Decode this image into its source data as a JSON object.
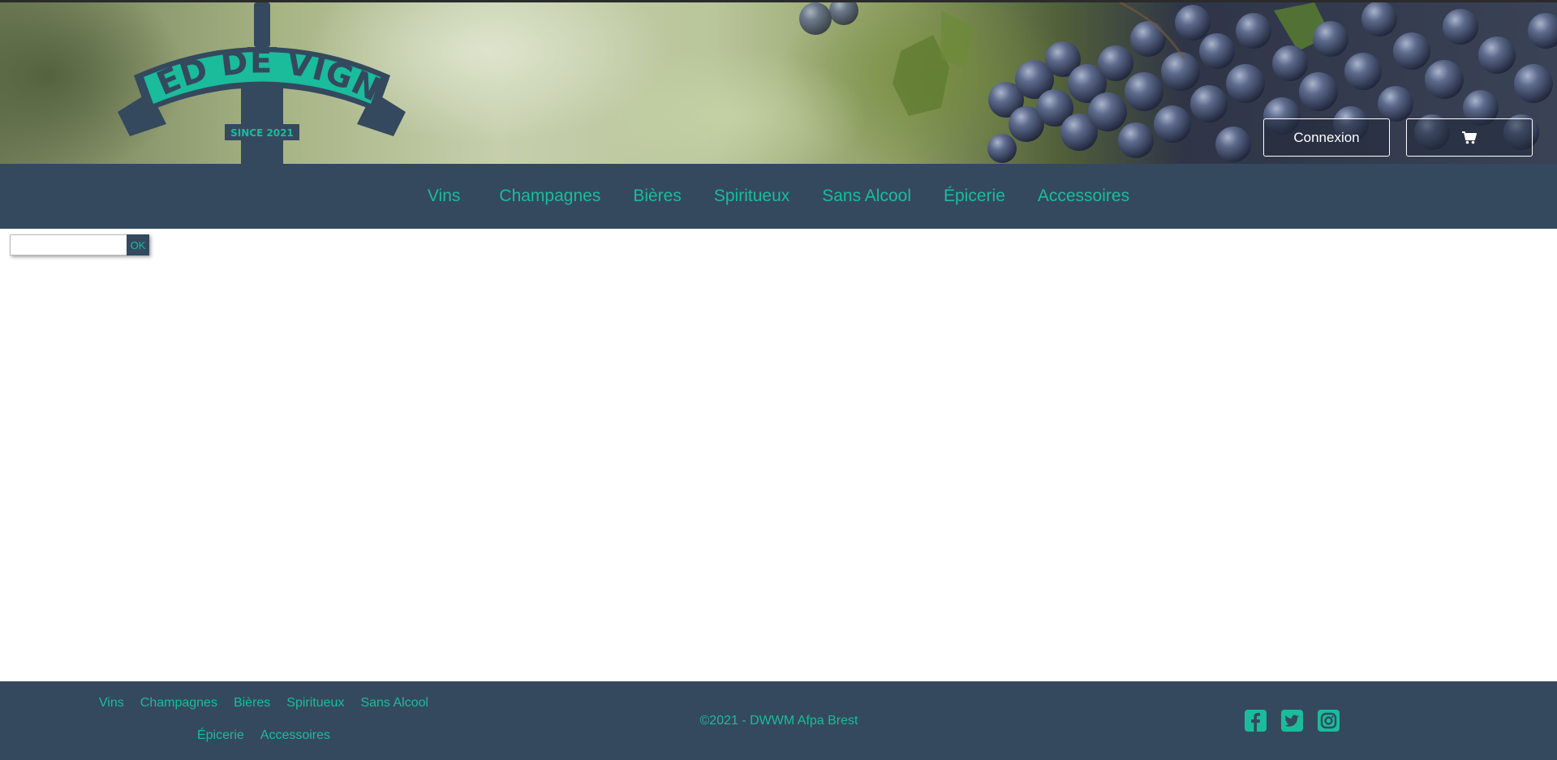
{
  "header": {
    "brand_name": "PIED DE VIGNE",
    "brand_since": "SINCE 2021",
    "login_label": "Connexion",
    "cart_icon": "shopping-cart-icon"
  },
  "nav": {
    "items": [
      {
        "label": "Vins"
      },
      {
        "label": "Champagnes"
      },
      {
        "label": "Bières"
      },
      {
        "label": "Spiritueux"
      },
      {
        "label": "Sans Alcool"
      },
      {
        "label": "Épicerie"
      },
      {
        "label": "Accessoires"
      }
    ]
  },
  "search": {
    "value": "",
    "submit_label": "OK"
  },
  "footer": {
    "links_row1": [
      "Vins",
      "Champagnes",
      "Bières",
      "Spiritueux",
      "Sans Alcool"
    ],
    "links_row2": [
      "Épicerie",
      "Accessoires"
    ],
    "copyright": "©2021 - DWWM Afpa Brest",
    "social": [
      "facebook-icon",
      "twitter-icon",
      "instagram-icon"
    ]
  },
  "colors": {
    "nav_bg": "#34495e",
    "accent": "#1abc9c",
    "white": "#ffffff"
  }
}
